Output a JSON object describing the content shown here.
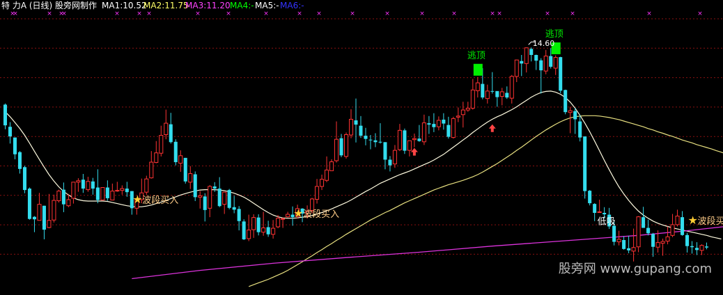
{
  "header": {
    "title": "特 力A (日线) 股旁网制作",
    "ma": [
      {
        "label": "MA1:10.52",
        "color": "#ffffff"
      },
      {
        "label": "MA2:11.75",
        "color": "#ffff66"
      },
      {
        "label": "MA3:11.20",
        "color": "#ff44ff"
      },
      {
        "label": "MA4:-",
        "color": "#00ff00"
      },
      {
        "label": "MA5:-",
        "color": "#ffffff"
      },
      {
        "label": "MA6:-",
        "color": "#3333ff"
      }
    ]
  },
  "watermark": "股旁网 www.gupang.com",
  "colors": {
    "up": "#ff3333",
    "down": "#33ddee",
    "ma1": "#fffbe0",
    "ma2": "#e8e080",
    "ma3": "#dd33dd",
    "signal": "#00ee00",
    "grid": "#8b1010"
  },
  "chart_data": {
    "type": "candlestick",
    "y_range": [
      8.1,
      15.5
    ],
    "peak_label": "14.60",
    "candles": [
      [
        13.0,
        12.42,
        13.03,
        12.31
      ],
      [
        12.38,
        12.11,
        12.51,
        11.91
      ],
      [
        12.08,
        11.61,
        12.08,
        11.47
      ],
      [
        11.67,
        11.2,
        11.7,
        11.07
      ],
      [
        11.25,
        10.61,
        11.29,
        10.52
      ],
      [
        10.65,
        9.8,
        10.68,
        9.78
      ],
      [
        9.86,
        9.79,
        9.88,
        9.43
      ],
      [
        9.76,
        10.21,
        10.53,
        9.76
      ],
      [
        10.17,
        9.5,
        10.17,
        9.23
      ],
      [
        9.56,
        9.76,
        10.5,
        9.54
      ],
      [
        9.77,
        10.32,
        10.48,
        9.7
      ],
      [
        10.31,
        10.58,
        10.62,
        10.26
      ],
      [
        10.62,
        10.21,
        10.82,
        9.99
      ],
      [
        10.17,
        10.34,
        10.5,
        10.13
      ],
      [
        10.38,
        10.83,
        10.84,
        10.23
      ],
      [
        10.83,
        10.87,
        10.94,
        10.56
      ],
      [
        10.9,
        10.65,
        11.06,
        10.53
      ],
      [
        10.62,
        10.85,
        10.98,
        10.56
      ],
      [
        10.85,
        10.65,
        10.95,
        10.48
      ],
      [
        10.68,
        10.33,
        11.19,
        10.24
      ],
      [
        10.33,
        10.68,
        10.69,
        10.32
      ],
      [
        10.68,
        10.38,
        10.88,
        10.31
      ],
      [
        10.33,
        10.58,
        10.79,
        10.32
      ],
      [
        10.58,
        10.6,
        10.84,
        10.56
      ],
      [
        10.6,
        10.65,
        10.74,
        10.48
      ],
      [
        10.65,
        10.55,
        10.84,
        10.42
      ],
      [
        10.58,
        10.1,
        10.58,
        9.92
      ],
      [
        10.1,
        10.36,
        10.37,
        9.92
      ],
      [
        10.34,
        10.53,
        10.93,
        10.24
      ],
      [
        10.55,
        10.92,
        11.01,
        10.48
      ],
      [
        10.95,
        11.39,
        11.7,
        10.93
      ],
      [
        11.38,
        11.65,
        11.98,
        11.36
      ],
      [
        11.64,
        12.14,
        12.41,
        11.55
      ],
      [
        12.16,
        12.48,
        12.86,
        12.03
      ],
      [
        12.45,
        11.95,
        12.77,
        11.91
      ],
      [
        11.96,
        11.39,
        12.03,
        11.3
      ],
      [
        11.36,
        11.57,
        11.72,
        11.12
      ],
      [
        11.51,
        10.85,
        11.51,
        10.79
      ],
      [
        10.83,
        11.07,
        11.28,
        10.64
      ],
      [
        11.05,
        10.41,
        11.13,
        10.3
      ],
      [
        10.41,
        10.45,
        10.58,
        10.09
      ],
      [
        10.43,
        10.05,
        10.52,
        9.73
      ],
      [
        10.1,
        10.71,
        10.75,
        9.85
      ],
      [
        10.71,
        10.65,
        10.83,
        10.56
      ],
      [
        10.65,
        10.16,
        10.97,
        10.13
      ],
      [
        10.21,
        10.55,
        10.56,
        9.94
      ],
      [
        10.61,
        10.11,
        10.64,
        10.07
      ],
      [
        10.13,
        10.06,
        10.45,
        9.96
      ],
      [
        10.08,
        9.74,
        10.16,
        9.48
      ],
      [
        9.73,
        9.23,
        9.79,
        9.21
      ],
      [
        9.25,
        9.49,
        9.92,
        9.18
      ],
      [
        9.5,
        9.84,
        9.93,
        9.27
      ],
      [
        9.84,
        9.43,
        9.93,
        9.34
      ],
      [
        9.43,
        9.55,
        10.0,
        9.33
      ],
      [
        9.57,
        9.37,
        9.75,
        9.3
      ],
      [
        9.37,
        9.54,
        9.77,
        9.25
      ],
      [
        9.58,
        9.82,
        9.91,
        9.54
      ],
      [
        9.81,
        9.81,
        9.84,
        9.55
      ],
      [
        9.86,
        9.93,
        10.0,
        9.84
      ],
      [
        9.92,
        9.85,
        10.15,
        9.61
      ],
      [
        9.87,
        10.09,
        10.2,
        9.81
      ],
      [
        10.09,
        9.95,
        10.1,
        9.71
      ],
      [
        9.96,
        10.01,
        10.18,
        9.81
      ],
      [
        10.04,
        10.36,
        10.39,
        9.96
      ],
      [
        10.35,
        10.71,
        10.92,
        10.23
      ],
      [
        10.71,
        10.91,
        11.04,
        10.61
      ],
      [
        10.88,
        11.17,
        11.55,
        10.83
      ],
      [
        11.15,
        11.4,
        11.47,
        11.15
      ],
      [
        11.43,
        12.03,
        12.53,
        11.38
      ],
      [
        12.06,
        11.58,
        12.18,
        11.53
      ],
      [
        11.55,
        12.16,
        12.22,
        11.49
      ],
      [
        12.15,
        12.59,
        12.87,
        12.06
      ],
      [
        12.56,
        12.44,
        13.17,
        11.94
      ],
      [
        12.41,
        12.13,
        12.68,
        12.07
      ],
      [
        12.13,
        12.04,
        12.35,
        11.86
      ],
      [
        12.02,
        12.01,
        12.15,
        11.75
      ],
      [
        12.0,
        11.95,
        12.2,
        11.81
      ],
      [
        11.96,
        11.94,
        12.48,
        11.91
      ],
      [
        11.95,
        11.46,
        11.95,
        11.19
      ],
      [
        11.46,
        11.3,
        11.56,
        11.13
      ],
      [
        11.34,
        11.72,
        11.87,
        11.23
      ],
      [
        11.74,
        12.28,
        12.46,
        11.7
      ],
      [
        12.28,
        11.71,
        12.33,
        11.62
      ],
      [
        11.72,
        11.99,
        11.99,
        11.55
      ],
      [
        12.02,
        12.05,
        12.19,
        11.81
      ],
      [
        12.05,
        11.98,
        12.43,
        11.96
      ],
      [
        11.96,
        12.49,
        12.72,
        11.87
      ],
      [
        12.48,
        12.44,
        12.68,
        12.18
      ],
      [
        12.46,
        12.37,
        12.76,
        12.23
      ],
      [
        12.38,
        12.56,
        12.67,
        12.28
      ],
      [
        12.58,
        12.47,
        12.76,
        12.3
      ],
      [
        12.43,
        12.1,
        12.66,
        12.05
      ],
      [
        12.08,
        12.61,
        12.66,
        12.05
      ],
      [
        12.65,
        12.68,
        12.92,
        12.51
      ],
      [
        12.72,
        12.85,
        13.08,
        12.36
      ],
      [
        12.85,
        12.9,
        13.08,
        12.8
      ],
      [
        12.9,
        13.41,
        13.72,
        12.86
      ],
      [
        13.39,
        13.61,
        13.77,
        13.2
      ],
      [
        13.58,
        13.2,
        14.02,
        13.15
      ],
      [
        13.17,
        13.38,
        13.56,
        13.03
      ],
      [
        13.38,
        13.37,
        13.91,
        13.31
      ],
      [
        13.38,
        13.21,
        13.35,
        12.94
      ],
      [
        13.23,
        13.36,
        13.47,
        12.98
      ],
      [
        13.33,
        13.2,
        13.51,
        13.16
      ],
      [
        13.18,
        13.79,
        13.83,
        13.03
      ],
      [
        13.79,
        14.25,
        14.26,
        13.63
      ],
      [
        14.22,
        14.15,
        14.39,
        13.8
      ],
      [
        14.15,
        14.59,
        14.6,
        13.9
      ],
      [
        14.56,
        14.39,
        14.6,
        14.21
      ],
      [
        14.39,
        14.23,
        14.4,
        13.97
      ],
      [
        14.24,
        13.96,
        14.3,
        13.31
      ],
      [
        13.94,
        14.36,
        14.53,
        13.85
      ],
      [
        14.36,
        14.06,
        14.58,
        14.01
      ],
      [
        14.02,
        14.32,
        14.38,
        13.83
      ],
      [
        14.33,
        13.39,
        14.34,
        13.32
      ],
      [
        13.41,
        12.79,
        13.42,
        12.73
      ],
      [
        12.78,
        12.83,
        12.94,
        12.2
      ],
      [
        12.82,
        12.59,
        12.91,
        12.18
      ],
      [
        12.53,
        12.08,
        12.71,
        11.97
      ],
      [
        12.11,
        10.58,
        12.11,
        10.37
      ],
      [
        10.59,
        10.24,
        10.61,
        10.18
      ],
      [
        10.22,
        9.97,
        10.24,
        9.74
      ],
      [
        9.99,
        10.0,
        10.34,
        9.97
      ],
      [
        9.97,
        9.93,
        10.13,
        9.81
      ],
      [
        9.92,
        9.59,
        10.11,
        9.52
      ],
      [
        9.61,
        9.16,
        9.77,
        9.06
      ],
      [
        9.16,
        9.23,
        9.47,
        9.06
      ],
      [
        9.21,
        8.96,
        9.32,
        8.94
      ],
      [
        8.98,
        8.92,
        9.33,
        8.84
      ],
      [
        8.9,
        9.0,
        9.53,
        8.61
      ],
      [
        9.02,
        9.86,
        9.88,
        8.87
      ],
      [
        9.85,
        9.55,
        10.14,
        9.55
      ],
      [
        9.55,
        9.4,
        9.78,
        9.34
      ],
      [
        9.38,
        9.02,
        9.41,
        8.74
      ],
      [
        9.01,
        9.14,
        9.48,
        8.86
      ],
      [
        9.12,
        9.17,
        9.25,
        8.77
      ],
      [
        9.18,
        9.3,
        9.59,
        9.09
      ],
      [
        9.34,
        9.64,
        9.94,
        9.29
      ],
      [
        9.64,
        9.88,
        10.06,
        9.59
      ],
      [
        9.85,
        9.35,
        10.02,
        9.33
      ],
      [
        9.35,
        9.04,
        9.41,
        8.86
      ],
      [
        9.04,
        9.01,
        9.18,
        8.83
      ],
      [
        8.99,
        8.93,
        9.15,
        8.79
      ],
      [
        8.92,
        9.06,
        9.09,
        8.79
      ],
      [
        9.03,
        9.0,
        9.14,
        8.95
      ]
    ],
    "ma1": [
      12.8,
      12.66,
      12.5,
      12.33,
      12.14,
      11.92,
      11.69,
      11.47,
      11.25,
      11.04,
      10.86,
      10.7,
      10.57,
      10.47,
      10.39,
      10.34,
      10.31,
      10.3,
      10.3,
      10.3,
      10.3,
      10.29,
      10.26,
      10.23,
      10.2,
      10.17,
      10.15,
      10.14,
      10.14,
      10.16,
      10.19,
      10.23,
      10.27,
      10.32,
      10.37,
      10.42,
      10.47,
      10.51,
      10.55,
      10.58,
      10.61,
      10.62,
      10.62,
      10.62,
      10.61,
      10.59,
      10.56,
      10.52,
      10.47,
      10.41,
      10.33,
      10.24,
      10.15,
      10.06,
      9.98,
      9.91,
      9.86,
      9.83,
      9.82,
      9.82,
      9.83,
      9.85,
      9.87,
      9.9,
      9.94,
      9.98,
      10.03,
      10.08,
      10.14,
      10.2,
      10.26,
      10.33,
      10.41,
      10.49,
      10.57,
      10.64,
      10.72,
      10.8,
      10.86,
      10.92,
      10.98,
      11.04,
      11.09,
      11.14,
      11.2,
      11.26,
      11.32,
      11.38,
      11.45,
      11.53,
      11.61,
      11.71,
      11.81,
      11.91,
      12.01,
      12.11,
      12.22,
      12.32,
      12.42,
      12.51,
      12.59,
      12.66,
      12.72,
      12.79,
      12.86,
      12.94,
      13.03,
      13.12,
      13.21,
      13.28,
      13.34,
      13.37,
      13.38,
      13.35,
      13.29,
      13.2,
      13.07,
      12.9,
      12.7,
      12.48,
      12.24,
      11.98,
      11.71,
      11.44,
      11.18,
      10.93,
      10.7,
      10.5,
      10.32,
      10.16,
      10.02,
      9.91,
      9.82,
      9.74,
      9.68,
      9.63,
      9.59,
      9.55,
      9.52,
      9.49,
      9.46,
      9.43,
      9.4,
      9.37,
      9.34,
      9.3,
      9.27,
      9.24
    ],
    "ma2": [
      null,
      null,
      null,
      null,
      null,
      null,
      null,
      null,
      null,
      null,
      null,
      null,
      null,
      null,
      null,
      null,
      null,
      null,
      null,
      null,
      null,
      null,
      null,
      null,
      null,
      null,
      null,
      null,
      null,
      null,
      null,
      null,
      null,
      null,
      null,
      null,
      null,
      null,
      null,
      null,
      null,
      null,
      null,
      null,
      null,
      null,
      null,
      null,
      null,
      null,
      7.91,
      7.96,
      8.01,
      8.06,
      8.11,
      8.17,
      8.23,
      8.29,
      8.36,
      8.44,
      8.52,
      8.6,
      8.69,
      8.77,
      8.86,
      8.94,
      9.03,
      9.11,
      9.2,
      9.28,
      9.37,
      9.45,
      9.53,
      9.61,
      9.69,
      9.77,
      9.84,
      9.91,
      9.98,
      10.04,
      10.11,
      10.18,
      10.25,
      10.31,
      10.37,
      10.43,
      10.49,
      10.55,
      10.61,
      10.66,
      10.71,
      10.76,
      10.8,
      10.84,
      10.88,
      10.93,
      10.98,
      11.04,
      11.11,
      11.19,
      11.27,
      11.35,
      11.44,
      11.53,
      11.62,
      11.72,
      11.81,
      11.91,
      12.01,
      12.11,
      12.2,
      12.29,
      12.37,
      12.45,
      12.52,
      12.58,
      12.63,
      12.66,
      12.68,
      12.69,
      12.69,
      12.69,
      12.68,
      12.66,
      12.64,
      12.61,
      12.58,
      12.54,
      12.5,
      12.46,
      12.42,
      12.38,
      12.33,
      12.29,
      12.24,
      12.2,
      12.15,
      12.11,
      12.06,
      12.01,
      11.97,
      11.93,
      11.88,
      11.84,
      11.8,
      11.76,
      11.71,
      11.67,
      11.62,
      11.57,
      11.52,
      11.47
    ],
    "ma3": [
      null,
      null,
      null,
      null,
      null,
      null,
      null,
      null,
      null,
      null,
      null,
      null,
      null,
      null,
      null,
      null,
      null,
      null,
      null,
      null,
      null,
      null,
      null,
      null,
      null,
      null,
      null,
      null,
      null,
      null,
      null,
      null,
      null,
      null,
      null,
      null,
      null,
      null,
      null,
      null,
      null,
      null,
      null,
      null,
      null,
      null,
      null,
      null,
      null,
      null,
      null,
      null,
      null,
      null,
      null,
      null,
      null,
      null,
      null,
      null,
      null,
      null,
      null,
      null,
      null,
      null,
      null,
      null,
      null,
      null,
      null,
      null,
      null,
      null,
      null,
      null,
      null,
      null,
      null,
      null,
      null,
      null,
      null,
      null,
      null,
      null,
      null,
      null,
      null,
      null,
      null,
      null,
      null,
      null,
      null,
      null,
      null,
      null,
      null,
      null,
      null,
      null,
      null,
      null,
      null,
      null,
      null,
      null,
      null,
      null,
      null,
      null,
      null,
      null,
      null,
      null,
      null,
      null,
      null,
      null,
      null,
      null,
      null,
      null,
      null,
      null,
      null,
      null,
      null,
      null,
      null,
      null,
      null,
      null,
      null,
      null,
      null,
      null,
      null,
      null,
      null,
      null,
      null,
      null,
      null,
      null,
      null,
      null,
      null,
      null
    ],
    "ma3_line": [
      [
        26,
        8.13
      ],
      [
        40,
        8.36
      ],
      [
        55,
        8.56
      ],
      [
        70,
        8.72
      ],
      [
        85,
        8.87
      ],
      [
        100,
        9.04
      ],
      [
        115,
        9.19
      ],
      [
        130,
        9.34
      ],
      [
        140,
        9.47
      ],
      [
        150,
        9.62
      ]
    ],
    "buy_markers": [
      {
        "i": 27,
        "price": 10.36,
        "label": "波段买入"
      },
      {
        "i": 60,
        "price": 9.97,
        "label": "波段买入"
      },
      {
        "i": 141,
        "price": 9.77,
        "label": "波段买入"
      }
    ],
    "escape_top": [
      {
        "i": 97,
        "price": 13.83,
        "label": "逃顶"
      },
      {
        "i": 113,
        "price": 14.43,
        "label": "逃顶"
      }
    ],
    "red_arrows": [
      {
        "i": 84,
        "price": 12.06
      },
      {
        "i": 100,
        "price": 12.72
      }
    ],
    "low_buy": {
      "i": 123,
      "price": 10.0,
      "label": "低吸"
    },
    "top_markers_x": [
      18,
      22,
      71,
      88,
      92,
      168,
      200,
      214,
      284,
      328,
      382,
      430,
      458,
      506,
      556,
      606,
      652,
      707,
      717,
      786,
      822,
      932,
      1005
    ]
  }
}
